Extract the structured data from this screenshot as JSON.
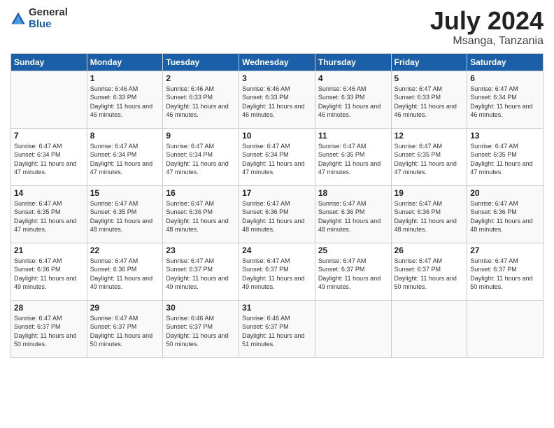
{
  "logo": {
    "general": "General",
    "blue": "Blue"
  },
  "title": {
    "month": "July 2024",
    "location": "Msanga, Tanzania"
  },
  "headers": [
    "Sunday",
    "Monday",
    "Tuesday",
    "Wednesday",
    "Thursday",
    "Friday",
    "Saturday"
  ],
  "weeks": [
    [
      {
        "day": "",
        "sunrise": "",
        "sunset": "",
        "daylight": ""
      },
      {
        "day": "1",
        "sunrise": "Sunrise: 6:46 AM",
        "sunset": "Sunset: 6:33 PM",
        "daylight": "Daylight: 11 hours and 46 minutes."
      },
      {
        "day": "2",
        "sunrise": "Sunrise: 6:46 AM",
        "sunset": "Sunset: 6:33 PM",
        "daylight": "Daylight: 11 hours and 46 minutes."
      },
      {
        "day": "3",
        "sunrise": "Sunrise: 6:46 AM",
        "sunset": "Sunset: 6:33 PM",
        "daylight": "Daylight: 11 hours and 46 minutes."
      },
      {
        "day": "4",
        "sunrise": "Sunrise: 6:46 AM",
        "sunset": "Sunset: 6:33 PM",
        "daylight": "Daylight: 11 hours and 46 minutes."
      },
      {
        "day": "5",
        "sunrise": "Sunrise: 6:47 AM",
        "sunset": "Sunset: 6:33 PM",
        "daylight": "Daylight: 11 hours and 46 minutes."
      },
      {
        "day": "6",
        "sunrise": "Sunrise: 6:47 AM",
        "sunset": "Sunset: 6:34 PM",
        "daylight": "Daylight: 11 hours and 46 minutes."
      }
    ],
    [
      {
        "day": "7",
        "sunrise": "Sunrise: 6:47 AM",
        "sunset": "Sunset: 6:34 PM",
        "daylight": "Daylight: 11 hours and 47 minutes."
      },
      {
        "day": "8",
        "sunrise": "Sunrise: 6:47 AM",
        "sunset": "Sunset: 6:34 PM",
        "daylight": "Daylight: 11 hours and 47 minutes."
      },
      {
        "day": "9",
        "sunrise": "Sunrise: 6:47 AM",
        "sunset": "Sunset: 6:34 PM",
        "daylight": "Daylight: 11 hours and 47 minutes."
      },
      {
        "day": "10",
        "sunrise": "Sunrise: 6:47 AM",
        "sunset": "Sunset: 6:34 PM",
        "daylight": "Daylight: 11 hours and 47 minutes."
      },
      {
        "day": "11",
        "sunrise": "Sunrise: 6:47 AM",
        "sunset": "Sunset: 6:35 PM",
        "daylight": "Daylight: 11 hours and 47 minutes."
      },
      {
        "day": "12",
        "sunrise": "Sunrise: 6:47 AM",
        "sunset": "Sunset: 6:35 PM",
        "daylight": "Daylight: 11 hours and 47 minutes."
      },
      {
        "day": "13",
        "sunrise": "Sunrise: 6:47 AM",
        "sunset": "Sunset: 6:35 PM",
        "daylight": "Daylight: 11 hours and 47 minutes."
      }
    ],
    [
      {
        "day": "14",
        "sunrise": "Sunrise: 6:47 AM",
        "sunset": "Sunset: 6:35 PM",
        "daylight": "Daylight: 11 hours and 47 minutes."
      },
      {
        "day": "15",
        "sunrise": "Sunrise: 6:47 AM",
        "sunset": "Sunset: 6:35 PM",
        "daylight": "Daylight: 11 hours and 48 minutes."
      },
      {
        "day": "16",
        "sunrise": "Sunrise: 6:47 AM",
        "sunset": "Sunset: 6:36 PM",
        "daylight": "Daylight: 11 hours and 48 minutes."
      },
      {
        "day": "17",
        "sunrise": "Sunrise: 6:47 AM",
        "sunset": "Sunset: 6:36 PM",
        "daylight": "Daylight: 11 hours and 48 minutes."
      },
      {
        "day": "18",
        "sunrise": "Sunrise: 6:47 AM",
        "sunset": "Sunset: 6:36 PM",
        "daylight": "Daylight: 11 hours and 48 minutes."
      },
      {
        "day": "19",
        "sunrise": "Sunrise: 6:47 AM",
        "sunset": "Sunset: 6:36 PM",
        "daylight": "Daylight: 11 hours and 48 minutes."
      },
      {
        "day": "20",
        "sunrise": "Sunrise: 6:47 AM",
        "sunset": "Sunset: 6:36 PM",
        "daylight": "Daylight: 11 hours and 48 minutes."
      }
    ],
    [
      {
        "day": "21",
        "sunrise": "Sunrise: 6:47 AM",
        "sunset": "Sunset: 6:36 PM",
        "daylight": "Daylight: 11 hours and 49 minutes."
      },
      {
        "day": "22",
        "sunrise": "Sunrise: 6:47 AM",
        "sunset": "Sunset: 6:36 PM",
        "daylight": "Daylight: 11 hours and 49 minutes."
      },
      {
        "day": "23",
        "sunrise": "Sunrise: 6:47 AM",
        "sunset": "Sunset: 6:37 PM",
        "daylight": "Daylight: 11 hours and 49 minutes."
      },
      {
        "day": "24",
        "sunrise": "Sunrise: 6:47 AM",
        "sunset": "Sunset: 6:37 PM",
        "daylight": "Daylight: 11 hours and 49 minutes."
      },
      {
        "day": "25",
        "sunrise": "Sunrise: 6:47 AM",
        "sunset": "Sunset: 6:37 PM",
        "daylight": "Daylight: 11 hours and 49 minutes."
      },
      {
        "day": "26",
        "sunrise": "Sunrise: 6:47 AM",
        "sunset": "Sunset: 6:37 PM",
        "daylight": "Daylight: 11 hours and 50 minutes."
      },
      {
        "day": "27",
        "sunrise": "Sunrise: 6:47 AM",
        "sunset": "Sunset: 6:37 PM",
        "daylight": "Daylight: 11 hours and 50 minutes."
      }
    ],
    [
      {
        "day": "28",
        "sunrise": "Sunrise: 6:47 AM",
        "sunset": "Sunset: 6:37 PM",
        "daylight": "Daylight: 11 hours and 50 minutes."
      },
      {
        "day": "29",
        "sunrise": "Sunrise: 6:47 AM",
        "sunset": "Sunset: 6:37 PM",
        "daylight": "Daylight: 11 hours and 50 minutes."
      },
      {
        "day": "30",
        "sunrise": "Sunrise: 6:46 AM",
        "sunset": "Sunset: 6:37 PM",
        "daylight": "Daylight: 11 hours and 50 minutes."
      },
      {
        "day": "31",
        "sunrise": "Sunrise: 6:46 AM",
        "sunset": "Sunset: 6:37 PM",
        "daylight": "Daylight: 11 hours and 51 minutes."
      },
      {
        "day": "",
        "sunrise": "",
        "sunset": "",
        "daylight": ""
      },
      {
        "day": "",
        "sunrise": "",
        "sunset": "",
        "daylight": ""
      },
      {
        "day": "",
        "sunrise": "",
        "sunset": "",
        "daylight": ""
      }
    ]
  ]
}
